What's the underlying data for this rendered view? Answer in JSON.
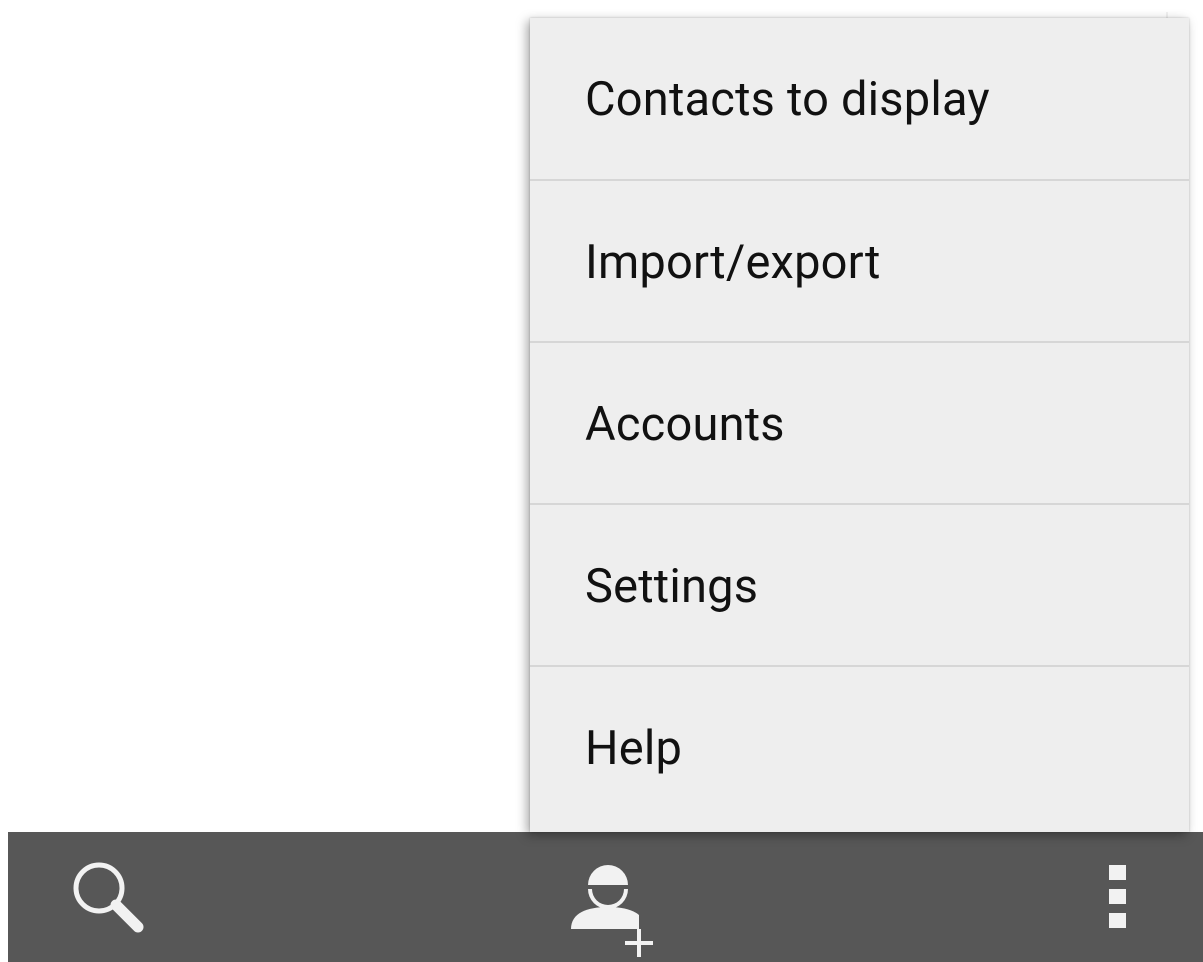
{
  "overflow_menu": {
    "items": [
      {
        "label": "Contacts to display"
      },
      {
        "label": "Import/export"
      },
      {
        "label": "Accounts"
      },
      {
        "label": "Settings"
      },
      {
        "label": "Help"
      }
    ]
  },
  "bottom_bar": {
    "buttons": [
      {
        "icon": "search-icon"
      },
      {
        "icon": "add-contact-icon"
      },
      {
        "icon": "overflow-menu-icon"
      }
    ]
  },
  "colors": {
    "menu_background": "#eeeeee",
    "bar_background": "#575757",
    "icon_color": "#f2f2f2"
  }
}
